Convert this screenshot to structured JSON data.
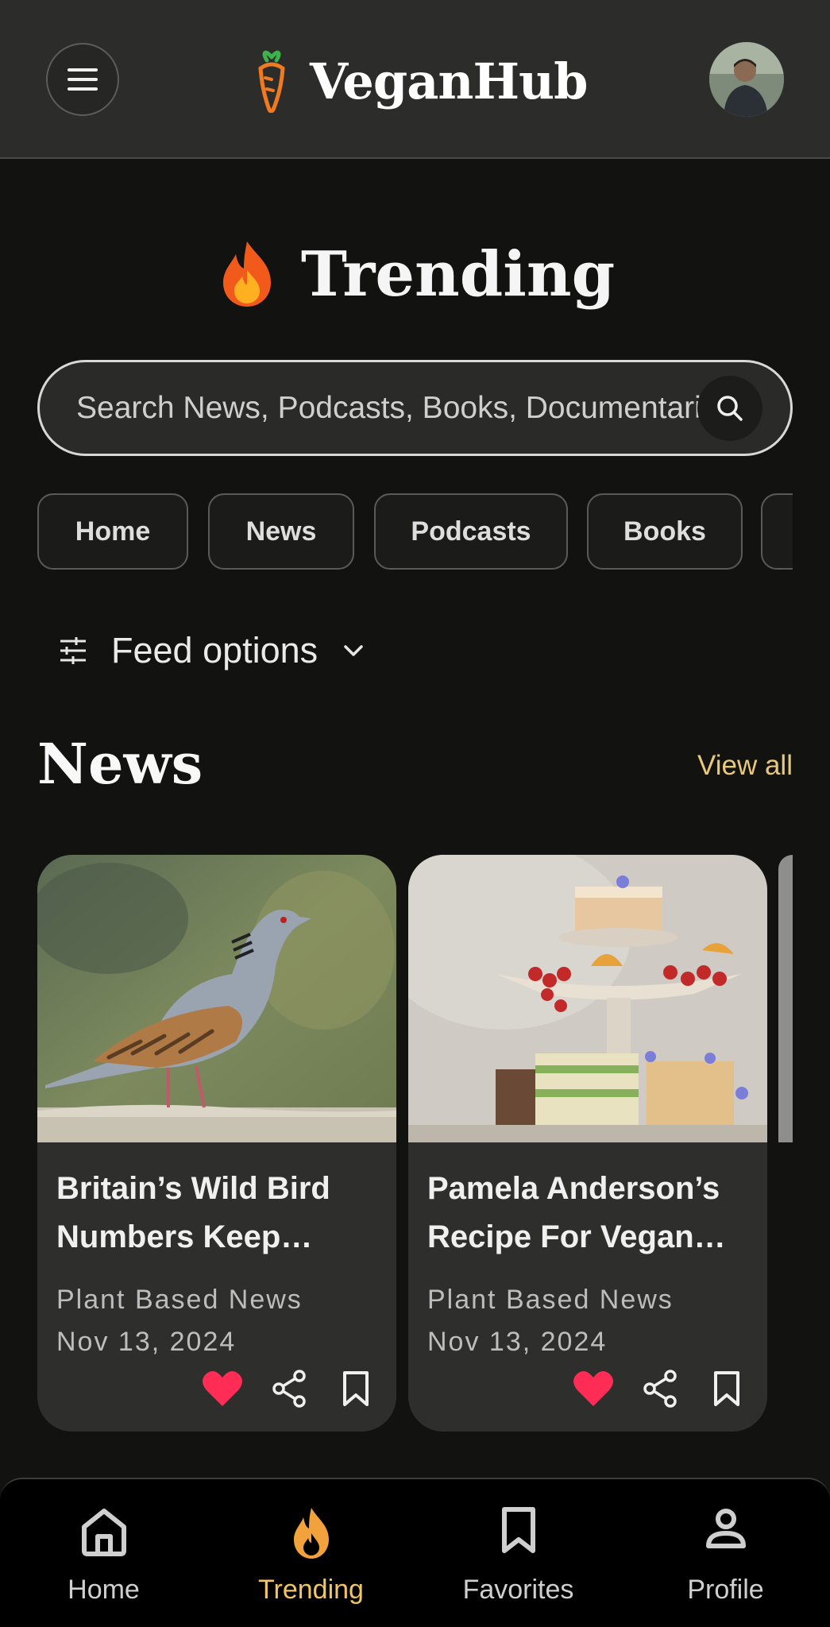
{
  "header": {
    "app_name": "VeganHub",
    "menu_icon": "hamburger-menu-icon",
    "logo_icon": "carrot-icon",
    "avatar": "user-avatar"
  },
  "page": {
    "title": "Trending",
    "title_icon": "fire-icon"
  },
  "search": {
    "placeholder": "Search News, Podcasts, Books, Documentaries"
  },
  "chips": [
    {
      "label": "Home"
    },
    {
      "label": "News"
    },
    {
      "label": "Podcasts"
    },
    {
      "label": "Books"
    },
    {
      "label": ""
    }
  ],
  "feed_options": {
    "label": "Feed options",
    "icon": "sliders-icon"
  },
  "news": {
    "title": "News",
    "view_all": "View all",
    "cards": [
      {
        "title": "Britain’s Wild Bird Numbers Keep…",
        "title_line1": "Britain’s Wild Bird",
        "title_line2": "Numbers Keep…",
        "source": "Plant Based News",
        "date": "Nov 13, 2024",
        "liked": true
      },
      {
        "title": "Pamela Anderson’s Recipe For Vegan…",
        "title_line1": "Pamela Anderson’s",
        "title_line2": "Recipe For Vegan…",
        "source": "Plant Based News",
        "date": "Nov 13, 2024",
        "liked": true
      }
    ]
  },
  "bottom_nav": {
    "items": [
      {
        "label": "Home",
        "icon": "home-icon",
        "active": false
      },
      {
        "label": "Trending",
        "icon": "fire-icon",
        "active": true
      },
      {
        "label": "Favorites",
        "icon": "bookmark-icon",
        "active": false
      },
      {
        "label": "Profile",
        "icon": "person-icon",
        "active": false
      }
    ]
  },
  "colors": {
    "accent": "#f2c468",
    "heart": "#ff2d55",
    "background": "#121210",
    "card": "#2e2e2d"
  }
}
